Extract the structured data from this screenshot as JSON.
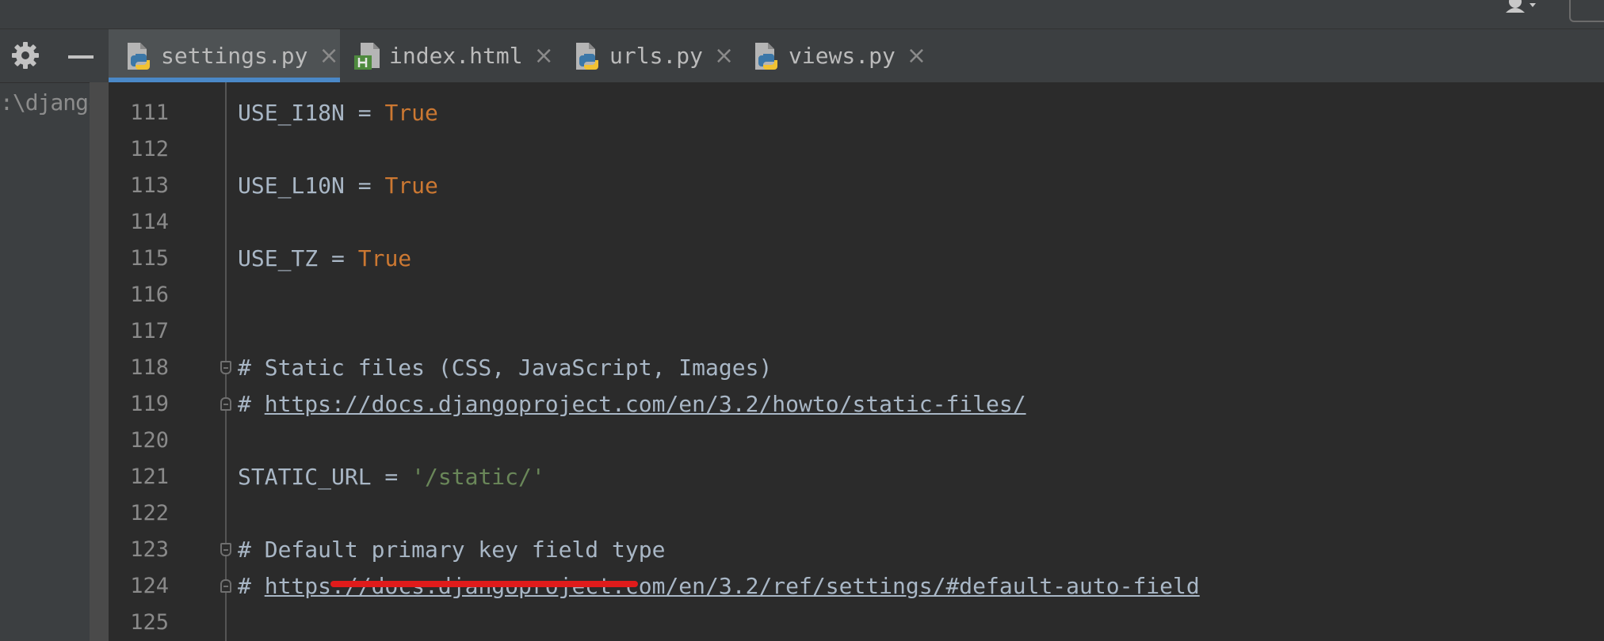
{
  "left_panel": {
    "path_text": ":\\djangoP"
  },
  "tabs": [
    {
      "label": "settings.py",
      "icon": "python-file-icon",
      "active": true
    },
    {
      "label": "index.html",
      "icon": "html-file-icon",
      "active": false
    },
    {
      "label": "urls.py",
      "icon": "python-file-icon",
      "active": false
    },
    {
      "label": "views.py",
      "icon": "python-file-icon",
      "active": false
    }
  ],
  "close_glyph": "×",
  "editor": {
    "lines": [
      {
        "num": "111",
        "name": "USE_I18N",
        "op": " = ",
        "value": "True"
      },
      {
        "num": "112"
      },
      {
        "num": "113",
        "name": "USE_L10N",
        "op": " = ",
        "value": "True"
      },
      {
        "num": "114"
      },
      {
        "num": "115",
        "name": "USE_TZ",
        "op": " = ",
        "value": "True"
      },
      {
        "num": "116"
      },
      {
        "num": "117"
      },
      {
        "num": "118",
        "comment": "# Static files (CSS, JavaScript, Images)"
      },
      {
        "num": "119",
        "hash": "# ",
        "url": "https://docs.djangoproject.com/en/3.2/howto/static-files/"
      },
      {
        "num": "120"
      },
      {
        "num": "121",
        "name": "STATIC_URL",
        "op": " = ",
        "string": "'/static/'"
      },
      {
        "num": "122"
      },
      {
        "num": "123",
        "comment": "# Default primary key field type"
      },
      {
        "num": "124",
        "hash": "# ",
        "url": "https://docs.djangoproject.com/en/3.2/ref/settings/#default-auto-field"
      },
      {
        "num": "125"
      }
    ]
  },
  "colors": {
    "keyword": "#cc7832",
    "string": "#6a8759",
    "identifier": "#a9b7c6",
    "annotation_underline": "#e01b1b",
    "active_tab_indicator": "#4a88c7"
  }
}
